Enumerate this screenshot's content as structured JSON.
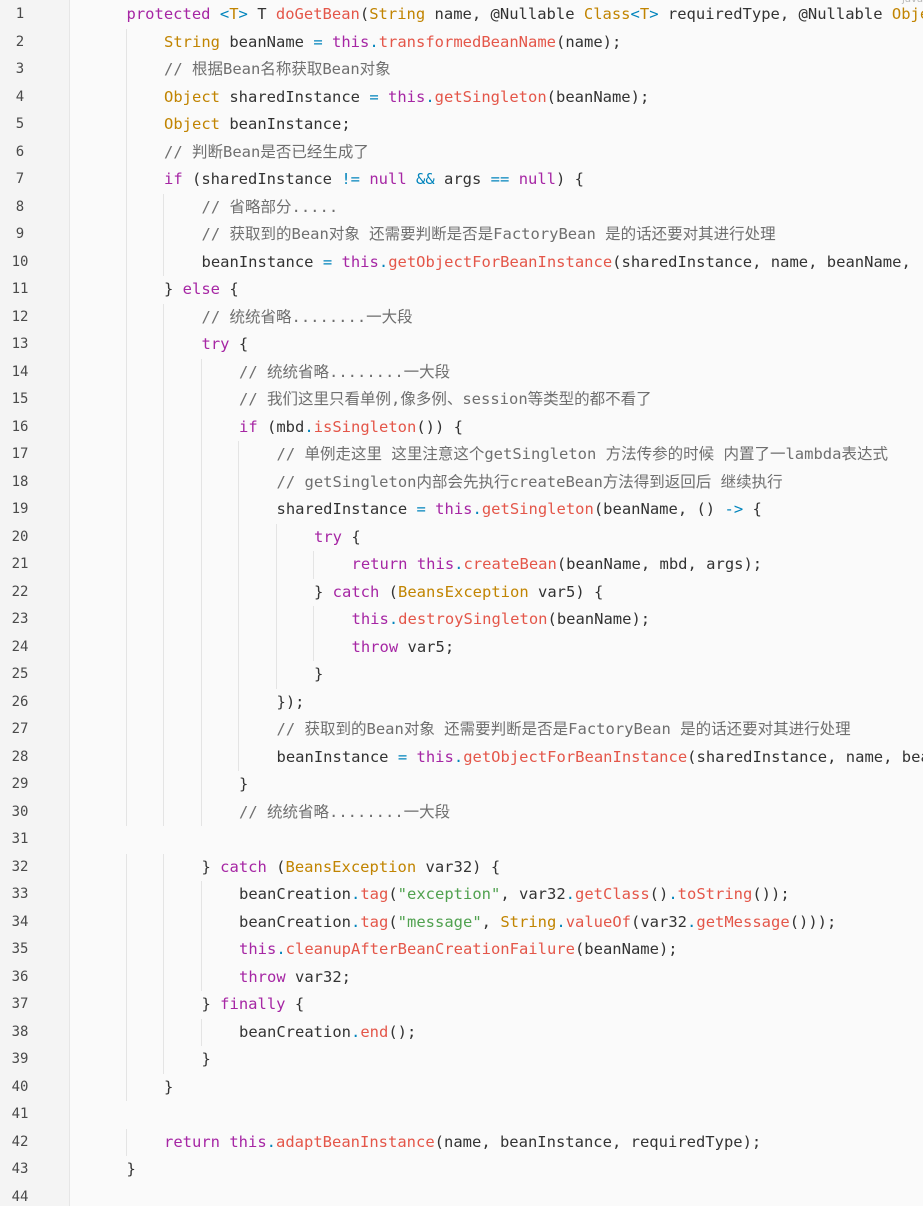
{
  "editor": {
    "language_badge": "java"
  },
  "colors": {
    "keyword": "#a626a4",
    "type": "#c18401",
    "method": "#e45649",
    "comment": "#6f6f6f",
    "string": "#50a14f",
    "operator": "#0184bc",
    "text": "#333333",
    "line_number": "#4a4a4a",
    "background": "#fafafa"
  },
  "lines": [
    {
      "n": "1",
      "indent": 1,
      "tokens": [
        [
          "protected",
          "kw"
        ],
        [
          " ",
          ""
        ],
        [
          "<",
          "op"
        ],
        [
          "T",
          "ty"
        ],
        [
          ">",
          "op"
        ],
        [
          " T ",
          "id"
        ],
        [
          "doGetBean",
          "fn"
        ],
        [
          "(",
          "id"
        ],
        [
          "String",
          "ty"
        ],
        [
          " name, @Nullable ",
          "id"
        ],
        [
          "Class",
          "ty"
        ],
        [
          "<",
          "op"
        ],
        [
          "T",
          "ty"
        ],
        [
          ">",
          "op"
        ],
        [
          " requiredType, @Nullable ",
          "id"
        ],
        [
          "Object",
          "ty"
        ]
      ]
    },
    {
      "n": "2",
      "indent": 2,
      "tokens": [
        [
          "String",
          "ty"
        ],
        [
          " beanName ",
          ""
        ],
        [
          "=",
          "op"
        ],
        [
          " ",
          ""
        ],
        [
          "this",
          "kw"
        ],
        [
          ".",
          "op"
        ],
        [
          "transformedBeanName",
          "fn"
        ],
        [
          "(name);",
          ""
        ]
      ]
    },
    {
      "n": "3",
      "indent": 2,
      "tokens": [
        [
          "// 根据Bean名称获取Bean对象",
          "cm"
        ]
      ]
    },
    {
      "n": "4",
      "indent": 2,
      "tokens": [
        [
          "Object",
          "ty"
        ],
        [
          " sharedInstance ",
          ""
        ],
        [
          "=",
          "op"
        ],
        [
          " ",
          ""
        ],
        [
          "this",
          "kw"
        ],
        [
          ".",
          "op"
        ],
        [
          "getSingleton",
          "fn"
        ],
        [
          "(beanName);",
          ""
        ]
      ]
    },
    {
      "n": "5",
      "indent": 2,
      "tokens": [
        [
          "Object",
          "ty"
        ],
        [
          " beanInstance;",
          ""
        ]
      ]
    },
    {
      "n": "6",
      "indent": 2,
      "tokens": [
        [
          "// 判断Bean是否已经生成了",
          "cm"
        ]
      ]
    },
    {
      "n": "7",
      "indent": 2,
      "tokens": [
        [
          "if",
          "kw"
        ],
        [
          " (sharedInstance ",
          ""
        ],
        [
          "!=",
          "op"
        ],
        [
          " ",
          ""
        ],
        [
          "null",
          "kw"
        ],
        [
          " ",
          ""
        ],
        [
          "&&",
          "op"
        ],
        [
          " args ",
          ""
        ],
        [
          "==",
          "op"
        ],
        [
          " ",
          ""
        ],
        [
          "null",
          "kw"
        ],
        [
          ") {",
          ""
        ]
      ]
    },
    {
      "n": "8",
      "indent": 3,
      "tokens": [
        [
          "// 省略部分.....",
          "cm"
        ]
      ]
    },
    {
      "n": "9",
      "indent": 3,
      "tokens": [
        [
          "// 获取到的Bean对象 还需要判断是否是FactoryBean 是的话还要对其进行处理",
          "cm"
        ]
      ]
    },
    {
      "n": "10",
      "indent": 3,
      "tokens": [
        [
          "beanInstance ",
          ""
        ],
        [
          "=",
          "op"
        ],
        [
          " ",
          ""
        ],
        [
          "this",
          "kw"
        ],
        [
          ".",
          "op"
        ],
        [
          "getObjectForBeanInstance",
          "fn"
        ],
        [
          "(sharedInstance, name, beanName, (RootBeanDefinition)null);",
          ""
        ]
      ]
    },
    {
      "n": "11",
      "indent": 2,
      "tokens": [
        [
          "} ",
          ""
        ],
        [
          "else",
          "kw"
        ],
        [
          " {",
          ""
        ]
      ]
    },
    {
      "n": "12",
      "indent": 3,
      "tokens": [
        [
          "// 统统省略........一大段",
          "cm"
        ]
      ]
    },
    {
      "n": "13",
      "indent": 3,
      "tokens": [
        [
          "try",
          "kw"
        ],
        [
          " {",
          ""
        ]
      ]
    },
    {
      "n": "14",
      "indent": 4,
      "tokens": [
        [
          "// 统统省略........一大段",
          "cm"
        ]
      ]
    },
    {
      "n": "15",
      "indent": 4,
      "tokens": [
        [
          "// 我们这里只看单例,像多例、session等类型的都不看了",
          "cm"
        ]
      ]
    },
    {
      "n": "16",
      "indent": 4,
      "tokens": [
        [
          "if",
          "kw"
        ],
        [
          " (mbd",
          ""
        ],
        [
          ".",
          "op"
        ],
        [
          "isSingleton",
          "fn"
        ],
        [
          "()) {",
          ""
        ]
      ]
    },
    {
      "n": "17",
      "indent": 5,
      "tokens": [
        [
          "// 单例走这里 这里注意这个getSingleton 方法传参的时候 内置了一lambda表达式",
          "cm"
        ]
      ]
    },
    {
      "n": "18",
      "indent": 5,
      "tokens": [
        [
          "// getSingleton内部会先执行createBean方法得到返回后 继续执行",
          "cm"
        ]
      ]
    },
    {
      "n": "19",
      "indent": 5,
      "tokens": [
        [
          "sharedInstance ",
          ""
        ],
        [
          "=",
          "op"
        ],
        [
          " ",
          ""
        ],
        [
          "this",
          "kw"
        ],
        [
          ".",
          "op"
        ],
        [
          "getSingleton",
          "fn"
        ],
        [
          "(beanName, () ",
          ""
        ],
        [
          "->",
          "op"
        ],
        [
          " {",
          ""
        ]
      ]
    },
    {
      "n": "20",
      "indent": 6,
      "tokens": [
        [
          "try",
          "kw"
        ],
        [
          " {",
          ""
        ]
      ]
    },
    {
      "n": "21",
      "indent": 7,
      "tokens": [
        [
          "return",
          "kw"
        ],
        [
          " ",
          ""
        ],
        [
          "this",
          "kw"
        ],
        [
          ".",
          "op"
        ],
        [
          "createBean",
          "fn"
        ],
        [
          "(beanName, mbd, args);",
          ""
        ]
      ]
    },
    {
      "n": "22",
      "indent": 6,
      "tokens": [
        [
          "} ",
          ""
        ],
        [
          "catch",
          "kw"
        ],
        [
          " (",
          ""
        ],
        [
          "BeansException",
          "ty"
        ],
        [
          " var5) {",
          ""
        ]
      ]
    },
    {
      "n": "23",
      "indent": 7,
      "tokens": [
        [
          "this",
          "kw"
        ],
        [
          ".",
          "op"
        ],
        [
          "destroySingleton",
          "fn"
        ],
        [
          "(beanName);",
          ""
        ]
      ]
    },
    {
      "n": "24",
      "indent": 7,
      "tokens": [
        [
          "throw",
          "kw"
        ],
        [
          " var5;",
          ""
        ]
      ]
    },
    {
      "n": "25",
      "indent": 6,
      "tokens": [
        [
          "}",
          ""
        ]
      ]
    },
    {
      "n": "26",
      "indent": 5,
      "tokens": [
        [
          "});",
          ""
        ]
      ]
    },
    {
      "n": "27",
      "indent": 5,
      "tokens": [
        [
          "// 获取到的Bean对象 还需要判断是否是FactoryBean 是的话还要对其进行处理",
          "cm"
        ]
      ]
    },
    {
      "n": "28",
      "indent": 5,
      "tokens": [
        [
          "beanInstance ",
          ""
        ],
        [
          "=",
          "op"
        ],
        [
          " ",
          ""
        ],
        [
          "this",
          "kw"
        ],
        [
          ".",
          "op"
        ],
        [
          "getObjectForBeanInstance",
          "fn"
        ],
        [
          "(sharedInstance, name, beanName, mbd);",
          ""
        ]
      ]
    },
    {
      "n": "29",
      "indent": 4,
      "tokens": [
        [
          "}",
          ""
        ]
      ]
    },
    {
      "n": "30",
      "indent": 4,
      "tokens": [
        [
          "// 统统省略........一大段",
          "cm"
        ]
      ]
    },
    {
      "n": "31",
      "indent": 0,
      "tokens": []
    },
    {
      "n": "32",
      "indent": 3,
      "tokens": [
        [
          "} ",
          ""
        ],
        [
          "catch",
          "kw"
        ],
        [
          " (",
          ""
        ],
        [
          "BeansException",
          "ty"
        ],
        [
          " var32) {",
          ""
        ]
      ]
    },
    {
      "n": "33",
      "indent": 4,
      "tokens": [
        [
          "beanCreation",
          ""
        ],
        [
          ".",
          "op"
        ],
        [
          "tag",
          "fn"
        ],
        [
          "(",
          ""
        ],
        [
          "\"exception\"",
          "st"
        ],
        [
          ", var32",
          ""
        ],
        [
          ".",
          "op"
        ],
        [
          "getClass",
          "fn"
        ],
        [
          "()",
          ""
        ],
        [
          ".",
          "op"
        ],
        [
          "toString",
          "fn"
        ],
        [
          "());",
          ""
        ]
      ]
    },
    {
      "n": "34",
      "indent": 4,
      "tokens": [
        [
          "beanCreation",
          ""
        ],
        [
          ".",
          "op"
        ],
        [
          "tag",
          "fn"
        ],
        [
          "(",
          ""
        ],
        [
          "\"message\"",
          "st"
        ],
        [
          ", ",
          ""
        ],
        [
          "String",
          "ty"
        ],
        [
          ".",
          "op"
        ],
        [
          "valueOf",
          "fn"
        ],
        [
          "(var32",
          ""
        ],
        [
          ".",
          "op"
        ],
        [
          "getMessage",
          "fn"
        ],
        [
          "()));",
          ""
        ]
      ]
    },
    {
      "n": "35",
      "indent": 4,
      "tokens": [
        [
          "this",
          "kw"
        ],
        [
          ".",
          "op"
        ],
        [
          "cleanupAfterBeanCreationFailure",
          "fn"
        ],
        [
          "(beanName);",
          ""
        ]
      ]
    },
    {
      "n": "36",
      "indent": 4,
      "tokens": [
        [
          "throw",
          "kw"
        ],
        [
          " var32;",
          ""
        ]
      ]
    },
    {
      "n": "37",
      "indent": 3,
      "tokens": [
        [
          "} ",
          ""
        ],
        [
          "finally",
          "kw"
        ],
        [
          " {",
          ""
        ]
      ]
    },
    {
      "n": "38",
      "indent": 4,
      "tokens": [
        [
          "beanCreation",
          ""
        ],
        [
          ".",
          "op"
        ],
        [
          "end",
          "fn"
        ],
        [
          "();",
          ""
        ]
      ]
    },
    {
      "n": "39",
      "indent": 3,
      "tokens": [
        [
          "}",
          ""
        ]
      ]
    },
    {
      "n": "40",
      "indent": 2,
      "tokens": [
        [
          "}",
          ""
        ]
      ]
    },
    {
      "n": "41",
      "indent": 0,
      "tokens": []
    },
    {
      "n": "42",
      "indent": 2,
      "tokens": [
        [
          "return",
          "kw"
        ],
        [
          " ",
          ""
        ],
        [
          "this",
          "kw"
        ],
        [
          ".",
          "op"
        ],
        [
          "adaptBeanInstance",
          "fn"
        ],
        [
          "(name, beanInstance, requiredType);",
          ""
        ]
      ]
    },
    {
      "n": "43",
      "indent": 1,
      "tokens": [
        [
          "}",
          ""
        ]
      ]
    },
    {
      "n": "44",
      "indent": 0,
      "tokens": []
    }
  ]
}
